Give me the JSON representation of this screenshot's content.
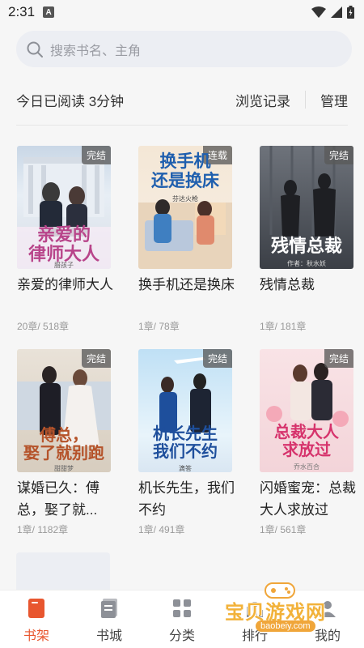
{
  "status": {
    "time": "2:31",
    "app_icon": "A"
  },
  "search": {
    "placeholder": "搜索书名、主角"
  },
  "reading": {
    "today_text": "今日已阅读 3分钟",
    "history_label": "浏览记录",
    "manage_label": "管理"
  },
  "books": [
    {
      "title": "亲爱的律师大人",
      "meta": "20章/ 518章",
      "badge": "完结",
      "cover_title": "亲爱的\n律师大人",
      "cover_author": "腊孩子",
      "accent": "#c04a8a"
    },
    {
      "title": "换手机还是换床",
      "meta": "1章/ 78章",
      "badge": "连载",
      "cover_title": "换手机\n还是换床",
      "cover_author": "芬达火枪",
      "accent": "#1f5fae"
    },
    {
      "title": "残情总裁",
      "meta": "1章/ 181章",
      "badge": "完结",
      "cover_title": "残情总裁",
      "cover_author": "作者：秋水妖",
      "accent": "#ffffff"
    },
    {
      "title": "谋婚已久：傅总，娶了就...",
      "meta": "1章/ 1182章",
      "badge": "完结",
      "cover_title": "傅总，\n娶了就别跑",
      "cover_author": "甜甜梦",
      "accent": "#b5532a"
    },
    {
      "title": "机长先生，我们不约",
      "meta": "1章/ 491章",
      "badge": "完结",
      "cover_title": "机长先生\n我们不约",
      "cover_author": "滴答",
      "accent": "#1e4f9c"
    },
    {
      "title": "闪婚蜜宠：总裁大人求放过",
      "meta": "1章/ 561章",
      "badge": "完结",
      "cover_title": "总裁大人\n求放过",
      "cover_author": "乔水百合",
      "accent": "#d6336c"
    }
  ],
  "tabs": [
    {
      "label": "书架",
      "icon": "bookshelf-icon",
      "active": true
    },
    {
      "label": "书城",
      "icon": "bookstore-icon",
      "active": false
    },
    {
      "label": "分类",
      "icon": "category-icon",
      "active": false
    },
    {
      "label": "排行",
      "icon": "ranking-icon",
      "active": false
    },
    {
      "label": "我的",
      "icon": "profile-icon",
      "active": false
    }
  ],
  "watermark": {
    "text": "宝贝游戏网",
    "url": "baobeiy.com"
  },
  "colors": {
    "active_tab": "#e8562f",
    "search_bg": "#eceef3",
    "page_bg": "#f6f6f6"
  }
}
